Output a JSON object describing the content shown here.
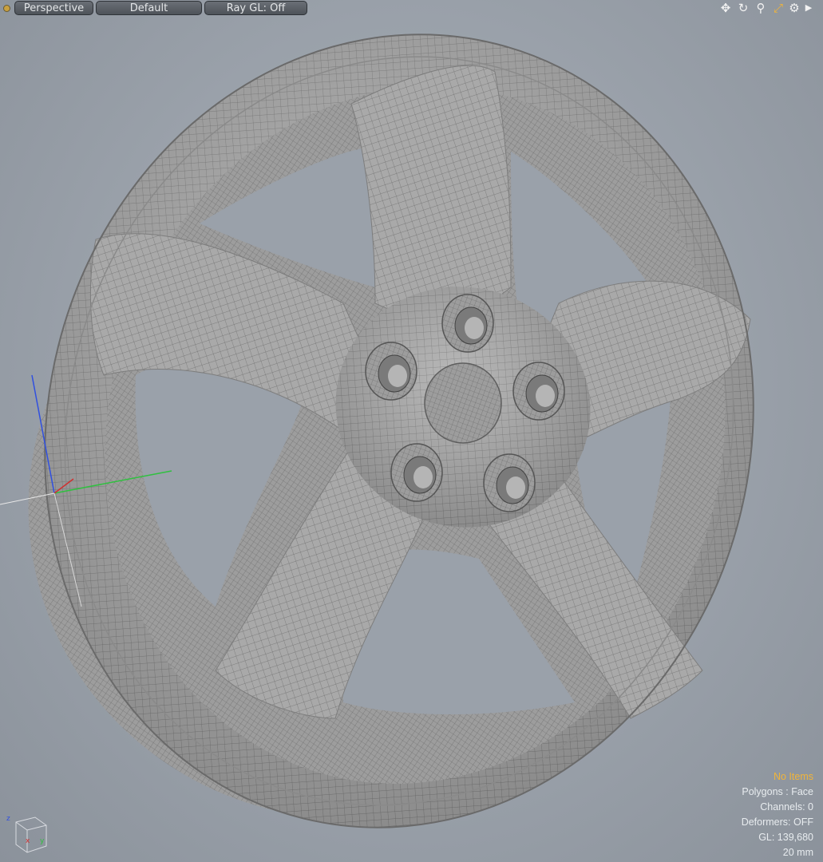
{
  "viewport_toolbar": {
    "view_mode": "Perspective",
    "shading": "Default",
    "raygl": "Ray GL: Off",
    "icons": [
      "move-view-icon",
      "rotate-view-icon",
      "zoom-view-icon",
      "fit-view-icon",
      "settings-icon",
      "expand-arrow-icon"
    ]
  },
  "info": {
    "items": "No Items",
    "polygons": "Polygons : Face",
    "channels": "Channels: 0",
    "deformers": "Deformers: OFF",
    "gl": "GL: 139,680",
    "grid": "20 mm"
  },
  "colors": {
    "accent_items": "#f0b43a",
    "axis_x": "#d03030",
    "axis_y": "#30c040",
    "axis_z": "#3050e0",
    "mesh": "#9c9c9c"
  },
  "axis_labels": {
    "x": "x",
    "y": "y",
    "z": "z"
  }
}
